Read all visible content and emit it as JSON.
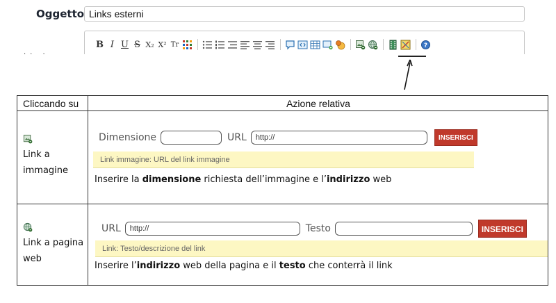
{
  "editor": {
    "subject_label": "Oggetto",
    "subject_value": "Links esterni",
    "toolbar": {
      "bold": "B",
      "italic": "I",
      "underline": "U",
      "strike": "S",
      "subscript": "X₂",
      "superscript": "X²",
      "font_size": "Tr"
    }
  },
  "table": {
    "header_left": "Cliccando su",
    "header_right": "Azione relativa",
    "rows": [
      {
        "label_line1": "Link a",
        "label_line2": "immagine",
        "field1_label": "Dimensione",
        "field2_label": "URL",
        "field2_value": "http://",
        "button": "INSERISCI",
        "hint": "Link immagine: URL del link immagine",
        "desc_parts": [
          "Inserire la ",
          "dimensione",
          " richiesta dell’immagine e l’",
          "indirizzo",
          " web"
        ]
      },
      {
        "label_line1": "Link a pagina",
        "label_line2": "web",
        "field1_label": "URL",
        "field1_value": "http://",
        "field2_label": "Testo",
        "button": "INSERISCI",
        "hint": "Link: Testo/descrizione del link",
        "desc_parts": [
          "Inserire l’",
          "indirizzo",
          " web della pagina e il ",
          "testo",
          " che conterrà il link"
        ]
      }
    ]
  },
  "colors": {
    "insert_button": "#c0392b",
    "hint_background": "#fdf7c3"
  }
}
